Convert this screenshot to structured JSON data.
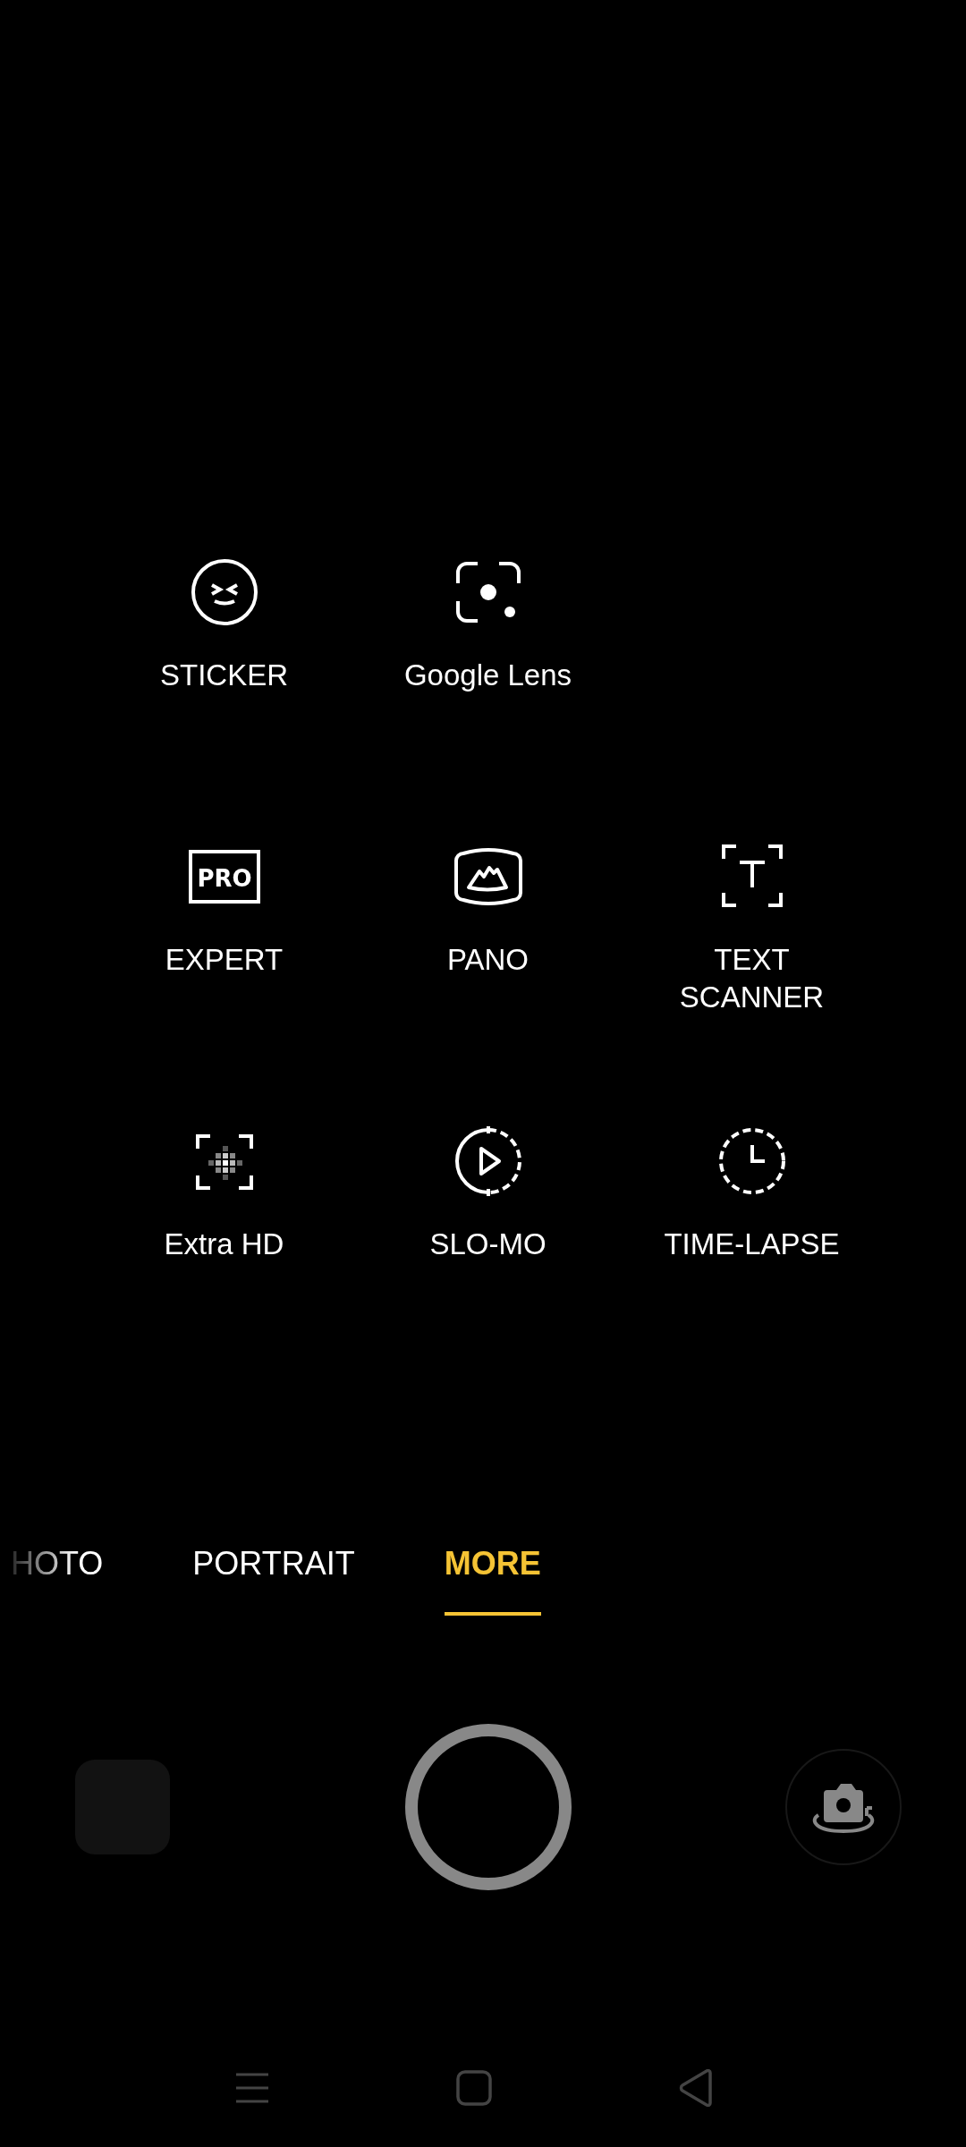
{
  "modes_grid": [
    {
      "label": "STICKER",
      "kind": "sticker"
    },
    {
      "label": "Google Lens",
      "kind": "lens"
    },
    {
      "kind": "empty"
    },
    {
      "label": "EXPERT",
      "kind": "pro",
      "badge": "PRO"
    },
    {
      "label": "PANO",
      "kind": "pano"
    },
    {
      "label": "TEXT SCANNER",
      "kind": "text"
    },
    {
      "label": "Extra HD",
      "kind": "hd"
    },
    {
      "label": "SLO-MO",
      "kind": "slomo"
    },
    {
      "label": "TIME-LAPSE",
      "kind": "timelapse"
    }
  ],
  "mode_tabs": [
    {
      "label": "HOTO",
      "selected": false
    },
    {
      "label": "PORTRAIT",
      "selected": false
    },
    {
      "label": "MORE",
      "selected": true
    }
  ]
}
